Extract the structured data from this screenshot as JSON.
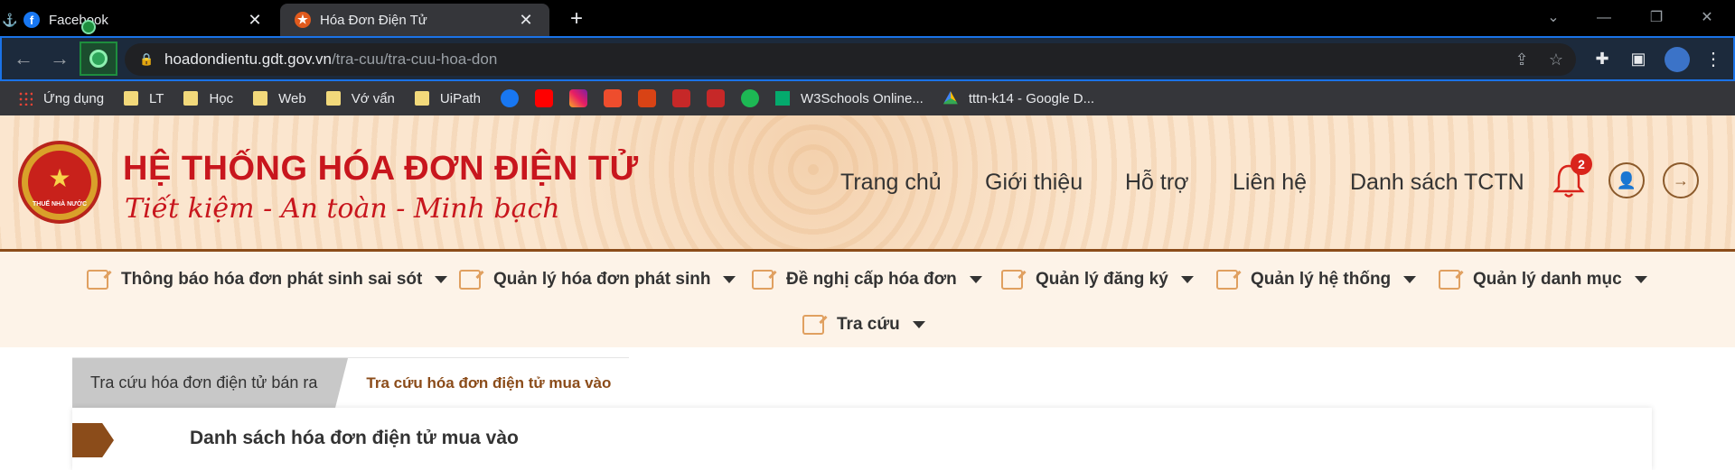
{
  "browser": {
    "tabs": [
      {
        "title": "Facebook",
        "active": false
      },
      {
        "title": "Hóa Đơn Điện Tử",
        "active": true
      }
    ],
    "url_domain": "hoadondientu.gdt.gov.vn",
    "url_path": "/tra-cuu/tra-cuu-hoa-don",
    "bookmarks": [
      {
        "label": "Ứng dụng",
        "icon": "apps-icon"
      },
      {
        "label": "LT",
        "icon": "folder-icon"
      },
      {
        "label": "Học",
        "icon": "folder-icon"
      },
      {
        "label": "Web",
        "icon": "folder-icon"
      },
      {
        "label": "Vớ vẩn",
        "icon": "folder-icon"
      },
      {
        "label": "UiPath",
        "icon": "folder-icon"
      },
      {
        "label": "W3Schools Online...",
        "icon": "w3schools-icon"
      },
      {
        "label": "tttn-k14 - Google D...",
        "icon": "google-drive-icon"
      }
    ]
  },
  "header": {
    "site_title": "HỆ THỐNG HÓA ĐƠN ĐIỆN TỬ",
    "slogan": "Tiết kiệm - An toàn - Minh bạch",
    "emblem_text": "THUẾ NHÀ NƯỚC",
    "nav": [
      "Trang chủ",
      "Giới thiệu",
      "Hỗ trợ",
      "Liên hệ",
      "Danh sách TCTN"
    ],
    "notification_count": "2"
  },
  "menu": [
    "Thông báo hóa đơn phát sinh sai sót",
    "Quản lý hóa đơn phát sinh",
    "Đề nghị cấp hóa đơn",
    "Quản lý đăng ký",
    "Quản lý hệ thống",
    "Quản lý danh mục",
    "Tra cứu"
  ],
  "content": {
    "tabs": [
      "Tra cứu hóa đơn điện tử bán ra",
      "Tra cứu hóa đơn điện tử mua vào"
    ],
    "panel_title": "Danh sách hóa đơn điện tử mua vào"
  },
  "colors": {
    "brand_red": "#c8161d",
    "brand_brown": "#8b4c1a",
    "header_bg": "#fbe6cf"
  }
}
